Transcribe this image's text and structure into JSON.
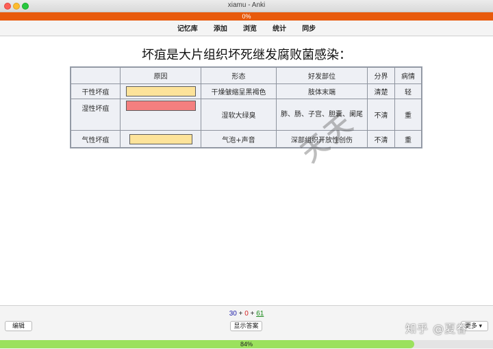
{
  "window": {
    "title": "xiamu - Anki"
  },
  "top_progress": {
    "label": "0%",
    "value": 0
  },
  "toolbar": {
    "items": [
      "记忆库",
      "添加",
      "浏览",
      "统计",
      "同步"
    ]
  },
  "card": {
    "title": "坏疽是大片组织坏死继发腐败菌感染：",
    "table": {
      "headers": [
        "",
        "原因",
        "形态",
        "好发部位",
        "分界",
        "病情"
      ],
      "rows": [
        {
          "type": "干性坏疽",
          "morphology": "干燥皱缩呈黑褐色",
          "site": "肢体末端",
          "boundary": "清楚",
          "severity": "轻"
        },
        {
          "type": "湿性坏疽",
          "morphology": "湿软大绿臭",
          "site": "肺、肠、子宫、胆囊、阑尾",
          "boundary": "不清",
          "severity": "重"
        },
        {
          "type": "气性坏疽",
          "morphology": "气泡+声音",
          "site": "深部组织开放性创伤",
          "boundary": "不清",
          "severity": "重"
        }
      ],
      "watermark": "天天"
    }
  },
  "counts": {
    "new": "30",
    "learn": "0",
    "review": "61",
    "sep": "+"
  },
  "buttons": {
    "edit": "编辑",
    "show_answer": "显示答案",
    "more": "更多"
  },
  "overlay_watermark": "知乎 @夏眷",
  "bottom_progress": {
    "label": "84%",
    "value": 0.84
  },
  "colors": {
    "top_progress": "#e85a0c",
    "bottom_progress": "#9be15d",
    "blank_yellow": "#fde39a",
    "blank_pink": "#f47f7f"
  }
}
